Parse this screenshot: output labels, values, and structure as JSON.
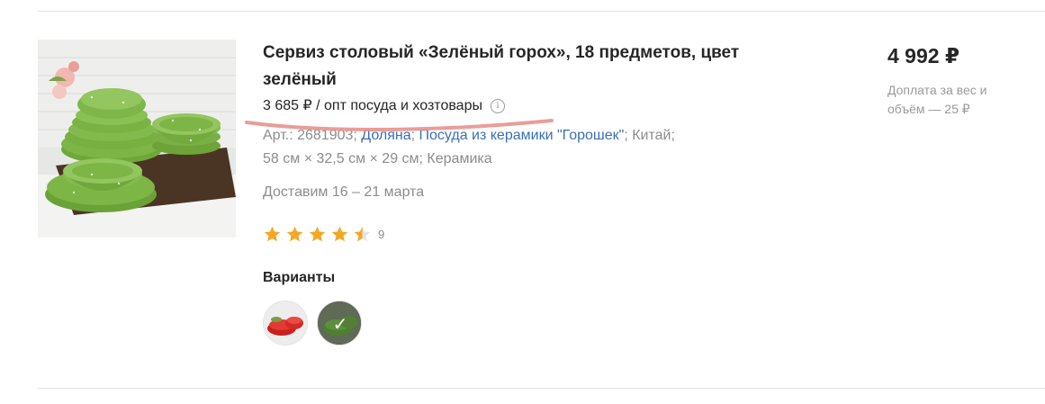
{
  "product": {
    "title": "Сервиз столовый «Зелёный горох», 18 предметов, цвет зелёный",
    "wholesale_price": "3 685 ₽ / опт посуда и хозтовары",
    "info_icon": "info-icon",
    "article": "Арт.: 2681903; ",
    "brand_link": "Доляна",
    "sep1": "; ",
    "collection_link": "Посуда из керамики \"Горошек\"",
    "country": "; Китай;",
    "dimensions": "58 см × 32,5 см × 29 см; Керамика",
    "delivery": "Доставим 16 – 21 марта",
    "rating": {
      "value": 4.5,
      "max": 5,
      "count": "9"
    },
    "variants_label": "Варианты",
    "variants": [
      {
        "name": "red",
        "selected": false
      },
      {
        "name": "green",
        "selected": true
      }
    ]
  },
  "pricing": {
    "price": "4 992 ₽",
    "surcharge_note": "Доплата за вес и объём — 25 ₽"
  },
  "colors": {
    "star": "#f5a623",
    "link": "#3b6fb6",
    "annotation_underline": "#e8928c"
  }
}
